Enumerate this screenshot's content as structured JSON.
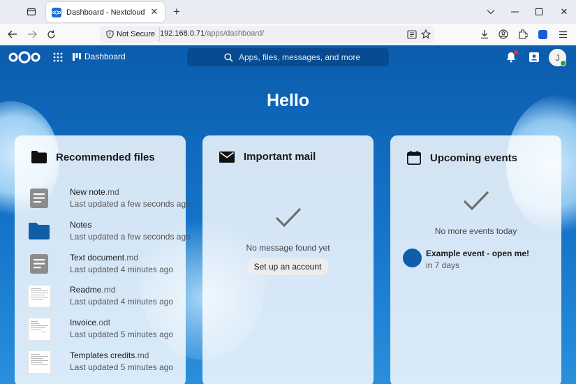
{
  "browser": {
    "tab_title": "Dashboard - Nextcloud",
    "new_tab": "+",
    "security_label": "Not Secure",
    "url_host": "192.168.0.71",
    "url_path": "/apps/dashboard/"
  },
  "header": {
    "app_label": "Dashboard",
    "search_placeholder": "Apps, files, messages, and more",
    "avatar_initial": "J"
  },
  "greeting": "Hello",
  "panels": {
    "files": {
      "title": "Recommended files",
      "items": [
        {
          "name": "New note",
          "ext": ".md",
          "sub": "Last updated a few seconds ago",
          "thumb": "text-doc-icon"
        },
        {
          "name": "Notes",
          "ext": "",
          "sub": "Last updated a few seconds ago",
          "thumb": "folder-icon"
        },
        {
          "name": "Text document",
          "ext": ".md",
          "sub": "Last updated 4 minutes ago",
          "thumb": "text-doc-icon"
        },
        {
          "name": "Readme",
          "ext": ".md",
          "sub": "Last updated 4 minutes ago",
          "thumb": "document-preview"
        },
        {
          "name": "Invoice",
          "ext": ".odt",
          "sub": "Last updated 5 minutes ago",
          "thumb": "document-preview"
        },
        {
          "name": "Templates credits",
          "ext": ".md",
          "sub": "Last updated 5 minutes ago",
          "thumb": "document-preview"
        }
      ]
    },
    "mail": {
      "title": "Important mail",
      "empty_text": "No message found yet",
      "setup_label": "Set up an account"
    },
    "events": {
      "title": "Upcoming events",
      "empty_text": "No more events today",
      "event_title": "Example event - open me!",
      "event_sub": "in 7 days"
    }
  },
  "colors": {
    "accent": "#0e5ea8",
    "header_bg": "#0b5cad",
    "status_online": "#2d9c3b",
    "notification": "#e9322d"
  }
}
